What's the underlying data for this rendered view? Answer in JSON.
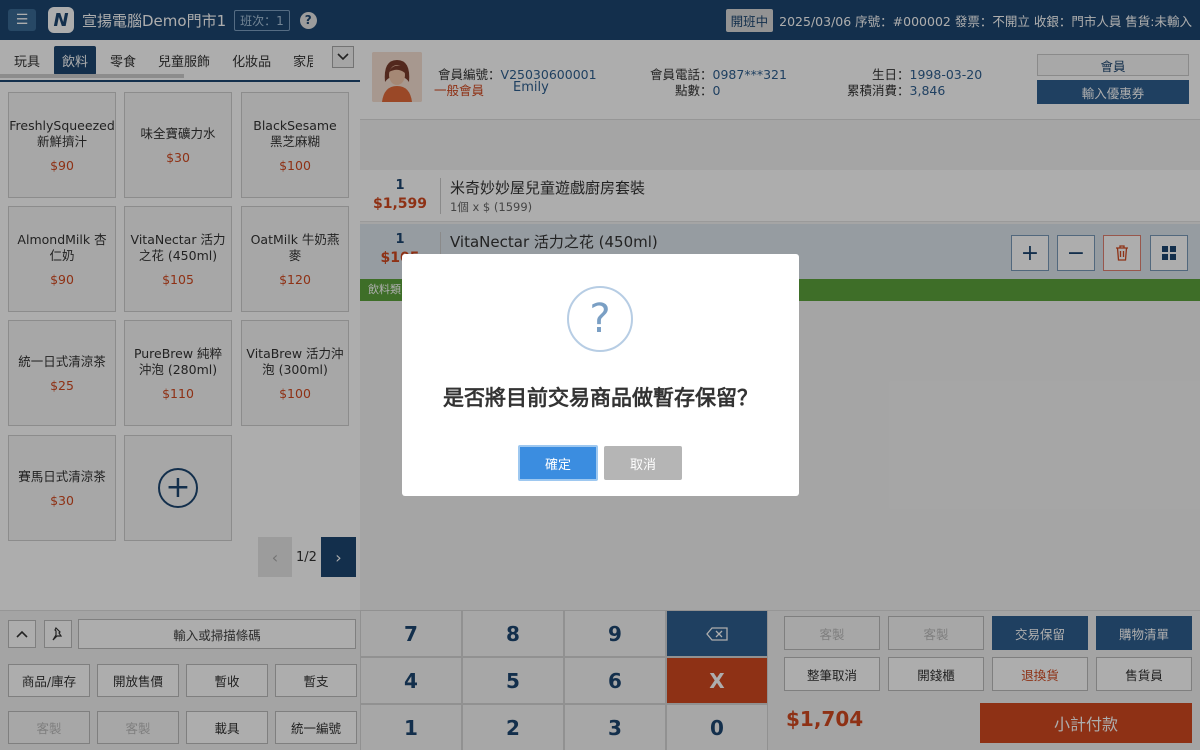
{
  "header": {
    "menu_icon": "☰",
    "logo_letter": "N",
    "store_name": "宣揚電腦Demo門市1",
    "shift": "班次：1",
    "help": "?",
    "status_badge": "開班中",
    "info": "2025/03/06 序號：#000002 發票：不開立 收銀：門市人員 售貨:未輸入"
  },
  "categories": {
    "items": [
      "玩具",
      "飲料",
      "零食",
      "兒童服飾",
      "化妝品",
      "家居"
    ],
    "active_index": 1,
    "more_icon": "chevron-down-icon"
  },
  "products": [
    {
      "name": "FreshlySqueezed 新鮮擠汁",
      "price": "$90"
    },
    {
      "name": "味全寶礦力水",
      "price": "$30"
    },
    {
      "name": "BlackSesame 黑芝麻糊",
      "price": "$100"
    },
    {
      "name": "AlmondMilk 杏仁奶",
      "price": "$90"
    },
    {
      "name": "VitaNectar 活力之花 (450ml)",
      "price": "$105"
    },
    {
      "name": "OatMilk 牛奶燕麥",
      "price": "$120"
    },
    {
      "name": "統一日式清涼茶",
      "price": "$25"
    },
    {
      "name": "PureBrew 純粹沖泡 (280ml)",
      "price": "$110"
    },
    {
      "name": "VitaBrew 活力沖泡 (300ml)",
      "price": "$100"
    },
    {
      "name": "賽馬日式清涼茶",
      "price": "$30"
    }
  ],
  "pager": {
    "text": "1/2",
    "prev": "‹",
    "next": "›"
  },
  "bottom_left": {
    "up_icon": "∧",
    "pin_icon": "📌",
    "scan_placeholder": "輸入或掃描條碼",
    "buttons": [
      "商品/庫存",
      "開放售價",
      "暫收",
      "暫支",
      "客製",
      "客製",
      "載具",
      "統一編號"
    ]
  },
  "member": {
    "id_label": "會員編號：",
    "id_value": "V25030600001",
    "level": "一般會員",
    "name": "Emily",
    "phone_label": "會員電話：",
    "phone_value": "0987***321",
    "points_label": "點數：",
    "points_value": "0",
    "birthday_label": "生日：",
    "birthday_value": "1998-03-20",
    "spend_label": "累積消費：",
    "spend_value": "3,846",
    "member_button": "會員",
    "coupon_button": "輸入優惠券"
  },
  "order_items": [
    {
      "qty": "1",
      "amount": "$1,599",
      "name": "米奇妙妙屋兒童遊戲廚房套裝",
      "detail": "1個 x $ (1599)"
    },
    {
      "qty": "1",
      "amount": "$105",
      "name": "VitaNectar 活力之花 (450ml)",
      "detail": ""
    }
  ],
  "promo_bar": "飲料類",
  "row_actions": {
    "plus": "+",
    "minus": "−",
    "delete_icon": "trash-icon",
    "grid_icon": "grid-icon"
  },
  "numpad": [
    "7",
    "8",
    "9",
    "⌫",
    "4",
    "5",
    "6",
    "X",
    "1",
    "2",
    "3",
    "0"
  ],
  "bottom_right": {
    "buttons": [
      "客製",
      "客製",
      "交易保留",
      "購物清單",
      "整筆取消",
      "開錢櫃",
      "退換貨",
      "售貨員"
    ],
    "total": "$1,704",
    "pay": "小計付款"
  },
  "dialog": {
    "icon": "?",
    "message": "是否將目前交易商品做暫存保留？",
    "ok": "確定",
    "cancel": "取消"
  }
}
